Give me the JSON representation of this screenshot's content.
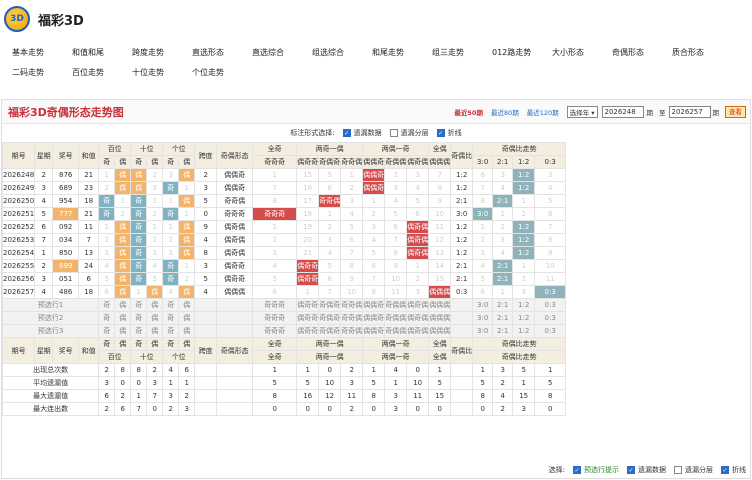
{
  "app": {
    "logo": "3D",
    "title": "福彩3D"
  },
  "nav": {
    "row1": [
      "基本走势",
      "和值和尾",
      "跨度走势",
      "直选形态",
      "直选综合",
      "组选综合",
      "和尾走势",
      "组三走势",
      "012路走势",
      "大小形态",
      "奇偶形态",
      "质合形态"
    ],
    "row2": [
      "二码走势",
      "百位走势",
      "十位走势",
      "个位走势"
    ]
  },
  "panel": {
    "title": "福彩3D奇偶形态走势图",
    "ranges": [
      "最近50期",
      "最近80期",
      "最近120期"
    ],
    "year_select": "选择年 ▾",
    "from": "2026248",
    "to": "2026257",
    "qi": "期",
    "zhi": "至",
    "go": "查看"
  },
  "options": {
    "label": "标注形式选择:",
    "items": [
      {
        "label": "遗漏数据",
        "on": true
      },
      {
        "label": "遗漏分层",
        "on": false
      },
      {
        "label": "折线",
        "on": true
      }
    ]
  },
  "headers": {
    "row1": [
      "期号",
      "星期",
      "奖号",
      "和值",
      "百位",
      "十位",
      "个位",
      "跨度",
      "奇偶形态",
      "全奇",
      "两奇一偶",
      "两偶一奇",
      "全偶",
      "奇偶比",
      "奇偶比走势"
    ],
    "oe": [
      "奇",
      "偶"
    ],
    "forms": [
      "偶奇奇",
      "奇偶奇",
      "奇奇偶",
      "偶偶奇",
      "奇偶偶",
      "偶奇偶"
    ],
    "allodd": "奇奇奇",
    "alleven": "偶偶偶",
    "ratio": [
      "3:0",
      "2:1",
      "1:2",
      "0:3"
    ]
  },
  "rows": [
    {
      "issue": "2026248",
      "wk": "2",
      "num": "876",
      "sum": "21",
      "b": [
        "1",
        "偶"
      ],
      "s": [
        "偶",
        "2"
      ],
      "g": [
        "3",
        "偶"
      ],
      "span": "2",
      "form": "偶偶奇",
      "q": "1",
      "o1": "15",
      "o2": "5",
      "o3": "1",
      "e1": "偶偶奇",
      "e2": "2",
      "e3": "3",
      "qe": "7",
      "ratio": "1:2",
      "rt": [
        "6",
        "3",
        "1:2",
        "3"
      ]
    },
    {
      "issue": "2026249",
      "wk": "3",
      "num": "689",
      "sum": "23",
      "b": [
        "2",
        "偶"
      ],
      "s": [
        "偶",
        "3"
      ],
      "g": [
        "奇",
        "1"
      ],
      "span": "3",
      "form": "偶偶奇",
      "q": "7",
      "o1": "16",
      "o2": "6",
      "o3": "2",
      "e1": "偶偶奇",
      "e2": "3",
      "e3": "4",
      "qe": "8",
      "ratio": "1:2",
      "rt": [
        "7",
        "4",
        "1:2",
        "4"
      ]
    },
    {
      "issue": "2026250",
      "wk": "4",
      "num": "954",
      "sum": "18",
      "b": [
        "奇",
        "1"
      ],
      "s": [
        "奇",
        "1"
      ],
      "g": [
        "1",
        "偶"
      ],
      "span": "5",
      "form": "奇奇偶",
      "q": "8",
      "o1": "17",
      "o2": "奇奇偶",
      "o3": "3",
      "e1": "1",
      "e2": "4",
      "e3": "5",
      "qe": "9",
      "ratio": "2:1",
      "rt": [
        "8",
        "2:1",
        "1",
        "5"
      ]
    },
    {
      "issue": "2026251",
      "wk": "5",
      "num": "777",
      "sum": "21",
      "b": [
        "奇",
        "2"
      ],
      "s": [
        "奇",
        "2"
      ],
      "g": [
        "奇",
        "1"
      ],
      "span": "0",
      "form": "奇奇奇",
      "q": "奇奇奇",
      "o1": "18",
      "o2": "1",
      "o3": "4",
      "e1": "2",
      "e2": "5",
      "e3": "6",
      "qe": "10",
      "ratio": "3:0",
      "rt": [
        "3:0",
        "1",
        "2",
        "6"
      ]
    },
    {
      "issue": "2026252",
      "wk": "6",
      "num": "092",
      "sum": "11",
      "b": [
        "1",
        "偶"
      ],
      "s": [
        "奇",
        "1"
      ],
      "g": [
        "1",
        "偶"
      ],
      "span": "9",
      "form": "偶奇偶",
      "q": "1",
      "o1": "19",
      "o2": "2",
      "o3": "5",
      "e1": "3",
      "e2": "6",
      "e3": "偶奇偶",
      "qe": "11",
      "ratio": "1:2",
      "rt": [
        "1",
        "2",
        "1:2",
        "7"
      ]
    },
    {
      "issue": "2026253",
      "wk": "7",
      "num": "034",
      "sum": "7",
      "b": [
        "2",
        "偶"
      ],
      "s": [
        "奇",
        "2"
      ],
      "g": [
        "2",
        "偶"
      ],
      "span": "4",
      "form": "偶奇偶",
      "q": "2",
      "o1": "20",
      "o2": "3",
      "o3": "6",
      "e1": "4",
      "e2": "7",
      "e3": "偶奇偶",
      "qe": "12",
      "ratio": "1:2",
      "rt": [
        "2",
        "3",
        "1:2",
        "8"
      ]
    },
    {
      "issue": "2026254",
      "wk": "1",
      "num": "850",
      "sum": "13",
      "b": [
        "3",
        "偶"
      ],
      "s": [
        "奇",
        "3"
      ],
      "g": [
        "3",
        "偶"
      ],
      "span": "8",
      "form": "偶奇偶",
      "q": "3",
      "o1": "21",
      "o2": "4",
      "o3": "7",
      "e1": "5",
      "e2": "8",
      "e3": "偶奇偶",
      "qe": "13",
      "ratio": "1:2",
      "rt": [
        "3",
        "4",
        "1:2",
        "9"
      ]
    },
    {
      "issue": "2026255",
      "wk": "2",
      "num": "699",
      "sum": "24",
      "b": [
        "4",
        "偶"
      ],
      "s": [
        "奇",
        "4"
      ],
      "g": [
        "奇",
        "1"
      ],
      "span": "3",
      "form": "偶奇奇",
      "q": "4",
      "o1": "偶奇奇",
      "o2": "5",
      "o3": "8",
      "e1": "6",
      "e2": "9",
      "e3": "1",
      "qe": "14",
      "ratio": "2:1",
      "rt": [
        "4",
        "2:1",
        "1",
        "10"
      ]
    },
    {
      "issue": "2026256",
      "wk": "3",
      "num": "051",
      "sum": "6",
      "b": [
        "5",
        "偶"
      ],
      "s": [
        "奇",
        "5"
      ],
      "g": [
        "奇",
        "2"
      ],
      "span": "5",
      "form": "偶奇奇",
      "q": "5",
      "o1": "偶奇奇",
      "o2": "6",
      "o3": "9",
      "e1": "7",
      "e2": "10",
      "e3": "2",
      "qe": "15",
      "ratio": "2:1",
      "rt": [
        "5",
        "2:1",
        "2",
        "11"
      ]
    },
    {
      "issue": "2026257",
      "wk": "4",
      "num": "486",
      "sum": "18",
      "b": [
        "6",
        "偶"
      ],
      "s": [
        "1",
        "偶"
      ],
      "g": [
        "4",
        "偶"
      ],
      "span": "4",
      "form": "偶偶偶",
      "q": "6",
      "o1": "1",
      "o2": "7",
      "o3": "10",
      "e1": "8",
      "e2": "11",
      "e3": "3",
      "qe": "偶偶偶",
      "ratio": "0:3",
      "rt": [
        "6",
        "1",
        "3",
        "0:3"
      ]
    }
  ],
  "predict": [
    "预选行1",
    "预选行2",
    "预选行3"
  ],
  "footer_head": [
    "期号",
    "星期",
    "奖号",
    "和值",
    "百位",
    "十位",
    "个位",
    "跨度",
    "奇偶形态",
    "全奇",
    "两奇一偶",
    "两偶一奇",
    "全偶",
    "奇偶比",
    "奇偶比走势"
  ],
  "stats": [
    {
      "label": "出现总次数",
      "oe": [
        "2",
        "8",
        "8",
        "2",
        "4",
        "6"
      ],
      "form": [
        "1",
        "1",
        "0",
        "2",
        "1",
        "4",
        "0",
        "1"
      ],
      "rt": [
        "1",
        "3",
        "5",
        "1"
      ]
    },
    {
      "label": "平均遗漏值",
      "oe": [
        "3",
        "0",
        "0",
        "3",
        "1",
        "1"
      ],
      "form": [
        "5",
        "5",
        "10",
        "3",
        "5",
        "1",
        "10",
        "5"
      ],
      "rt": [
        "5",
        "2",
        "1",
        "5"
      ]
    },
    {
      "label": "最大遗漏值",
      "oe": [
        "6",
        "2",
        "1",
        "7",
        "3",
        "2"
      ],
      "form": [
        "8",
        "16",
        "12",
        "11",
        "8",
        "3",
        "11",
        "15"
      ],
      "rt": [
        "8",
        "4",
        "15",
        "8"
      ]
    },
    {
      "label": "最大连出数",
      "oe": [
        "2",
        "6",
        "7",
        "0",
        "2",
        "3"
      ],
      "form": [
        "0",
        "0",
        "0",
        "2",
        "0",
        "3",
        "0",
        "0"
      ],
      "rt": [
        "0",
        "2",
        "3",
        "0"
      ]
    }
  ],
  "footer": {
    "label": "选择:",
    "items": [
      {
        "label": "预选行提示",
        "on": true
      },
      {
        "label": "遗漏数据",
        "on": true
      },
      {
        "label": "遗漏分层",
        "on": false
      },
      {
        "label": "折线",
        "on": true
      }
    ]
  }
}
